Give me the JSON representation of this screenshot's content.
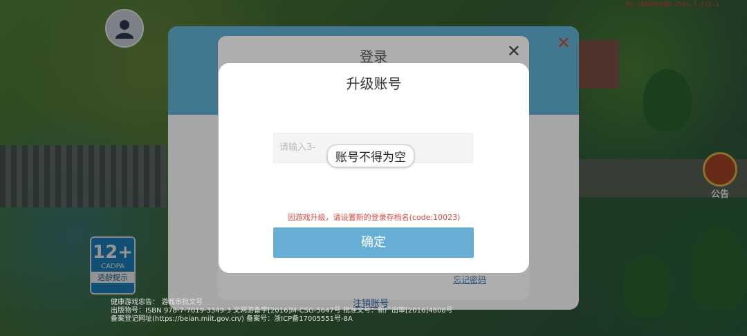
{
  "debug_id": "01-105867408-2541,7-121-1",
  "notice": {
    "label": "公告"
  },
  "age_rating": {
    "number": "12+",
    "org": "CADPA",
    "tip": "适龄提示"
  },
  "login_panel": {
    "title": "登录",
    "forgot_password": "忘记密码",
    "logout": "注销账号"
  },
  "legal_text": [
    "健康游戏忠告：",
    "游戏审批文号",
    "出版物号：ISBN 978-7-7019-3349-3",
    "备案登记网址(https://beian.miit.gov.cn/)",
    "文网游备字[2016]M-CSG-5647号",
    "备案号：浙ICP备17005551号-8A",
    "批准文号：新广出审[2016]4808号"
  ],
  "dialog": {
    "title": "升级账号",
    "input_placeholder": "请输入3-",
    "toast": "账号不得为空",
    "error": "因游戏升级，请设置新的登录存档名(code:10023)",
    "confirm": "确定"
  }
}
